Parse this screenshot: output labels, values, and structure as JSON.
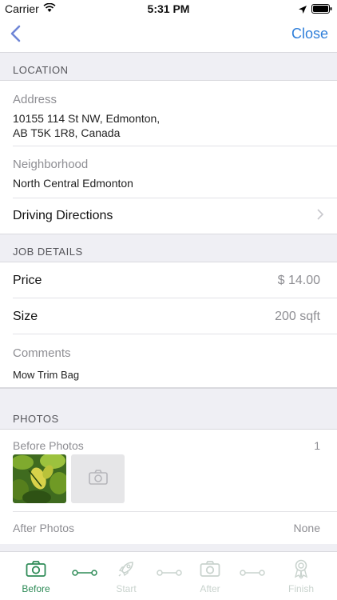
{
  "status": {
    "carrier": "Carrier",
    "time": "5:31 PM"
  },
  "nav": {
    "close_label": "Close"
  },
  "location": {
    "header": "LOCATION",
    "address_label": "Address",
    "address_line1": "10155 114 St NW, Edmonton,",
    "address_line2": "AB T5K 1R8, Canada",
    "neighborhood_label": "Neighborhood",
    "neighborhood_value": "North Central Edmonton",
    "directions_label": "Driving Directions"
  },
  "job": {
    "header": "JOB DETAILS",
    "price_label": "Price",
    "price_value": "$ 14.00",
    "size_label": "Size",
    "size_value": "200 sqft",
    "comments_label": "Comments",
    "comments_value": "Mow Trim Bag"
  },
  "photos": {
    "header": "PHOTOS",
    "before_label": "Before Photos",
    "before_count": "1",
    "after_label": "After Photos",
    "after_count": "None"
  },
  "tabs": [
    {
      "label": "Before",
      "icon": "camera-icon",
      "active": true
    },
    {
      "label": "Start",
      "icon": "rocket-icon",
      "active": false
    },
    {
      "label": "After",
      "icon": "camera-icon",
      "active": false
    },
    {
      "label": "Finish",
      "icon": "award-icon",
      "active": false
    }
  ],
  "colors": {
    "accent": "#2f7fda",
    "active_tab": "#2e8b57",
    "inactive_tab": "#c9d3ce",
    "background": "#efeff4"
  }
}
